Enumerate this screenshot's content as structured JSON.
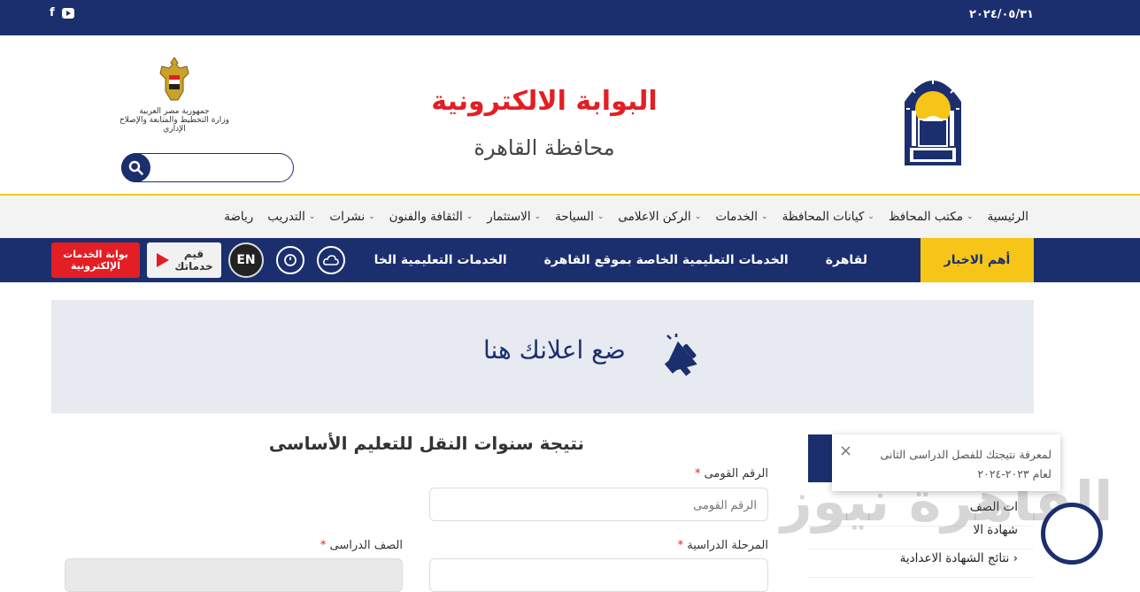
{
  "topbar": {
    "date": "٢٠٢٤/٠٥/٣١",
    "social": [
      "facebook-icon",
      "youtube-icon"
    ],
    "facebook_glyph": "f"
  },
  "header": {
    "title": "البوابة الالكترونية",
    "subtitle": "محافظة القاهرة",
    "egypt_logo_line1": "جمهورية مصر العربية",
    "egypt_logo_line2": "وزارة التخطيط والمتابعة والإصلاح الإداري",
    "search_placeholder": ""
  },
  "nav": {
    "items": [
      {
        "label": "الرئيسية",
        "dropdown": false
      },
      {
        "label": "مكتب المحافظ",
        "dropdown": true
      },
      {
        "label": "كيانات المحافظة",
        "dropdown": true
      },
      {
        "label": "الخدمات",
        "dropdown": true
      },
      {
        "label": "الركن الاعلامى",
        "dropdown": true
      },
      {
        "label": "السياحة",
        "dropdown": true
      },
      {
        "label": "الاستثمار",
        "dropdown": true
      },
      {
        "label": "الثقافة والفنون",
        "dropdown": true
      },
      {
        "label": "نشرات",
        "dropdown": true
      },
      {
        "label": "التدريب",
        "dropdown": true
      },
      {
        "label": "رياضة",
        "dropdown": false
      }
    ]
  },
  "newsbar": {
    "label": "أهم الاخبار",
    "items": [
      "لقاهرة",
      "الخدمات التعليمية الخاصة بموقع القاهرة",
      "الخدمات التعليمية الخا"
    ],
    "en_label": "EN",
    "gov_services": [
      "بوابة الخدمات",
      "الإلكترونية"
    ],
    "rate_services": [
      "قيم",
      "خدماتك"
    ]
  },
  "ad": {
    "text": "ضع اعلانك هنا"
  },
  "form": {
    "title": "نتيجة سنوات النقل للتعليم الأساسى",
    "national_id_label": "الرقم القومى",
    "national_id_placeholder": "الرقم القومى",
    "stage_label": "المرحلة الدراسية",
    "grade_label": "الصف الدراسى",
    "required_mark": "*"
  },
  "sidebar": {
    "items": [
      "نتائج الشهادة الاعدادية"
    ],
    "partial_items": [
      "شهادة الا",
      "ات الصف"
    ]
  },
  "popup": {
    "message": "لمعرفة نتيجتك للفصل الدراسى الثانى لعام ٢٠٢٣-٢٠٢٤",
    "close": "×"
  },
  "watermark": "القاهرة نيوز",
  "colors": {
    "primary": "#1b2f6e",
    "accent_yellow": "#f6c517",
    "title_red": "#e31e24"
  }
}
